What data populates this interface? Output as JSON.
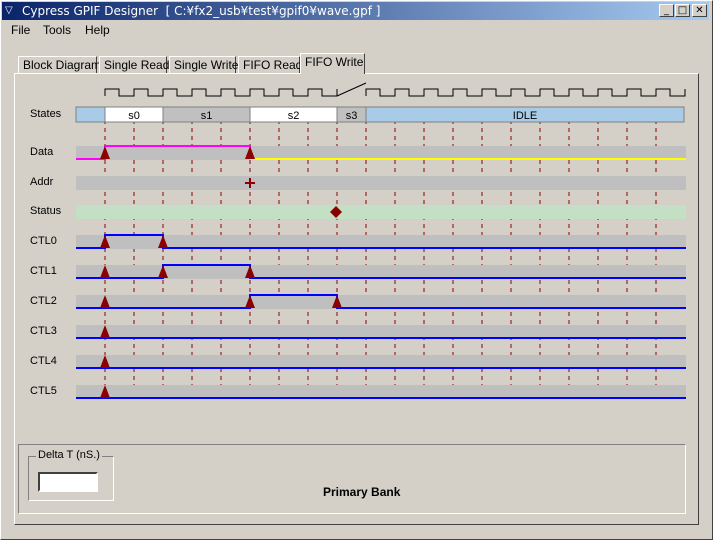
{
  "window": {
    "title": "Cypress GPIF Designer  [ C:¥fx2_usb¥test¥gpif0¥wave.gpf ]"
  },
  "menu": {
    "items": [
      {
        "label": "File"
      },
      {
        "label": "Tools"
      },
      {
        "label": "Help"
      }
    ]
  },
  "tabs": [
    {
      "label": "Block Diagram"
    },
    {
      "label": "Single Read"
    },
    {
      "label": "Single Write"
    },
    {
      "label": "FIFO Read"
    },
    {
      "label": "FIFO Write",
      "active": true
    }
  ],
  "rows": {
    "states": "States",
    "data": "Data",
    "addr": "Addr",
    "status": "Status",
    "ctl0": "CTL0",
    "ctl1": "CTL1",
    "ctl2": "CTL2",
    "ctl3": "CTL3",
    "ctl4": "CTL4",
    "ctl5": "CTL5"
  },
  "states": [
    {
      "name": "s0"
    },
    {
      "name": "s1"
    },
    {
      "name": "s2"
    },
    {
      "name": "s3"
    },
    {
      "name": "IDLE"
    }
  ],
  "bottom": {
    "delta_label": "Delta T (nS.)",
    "delta_value": "",
    "bank_label": "Primary Bank"
  },
  "colors": {
    "idle_state": "#a8cce8",
    "alt_state": "#c0c0c0",
    "track": "#bfbfbf",
    "status_track": "#c4e0c4",
    "ctl_line": "#0000ff",
    "data_high": "#ff00ff",
    "data_low": "#ffff00",
    "marker": "#8b0000",
    "grid": "#8b0000"
  }
}
